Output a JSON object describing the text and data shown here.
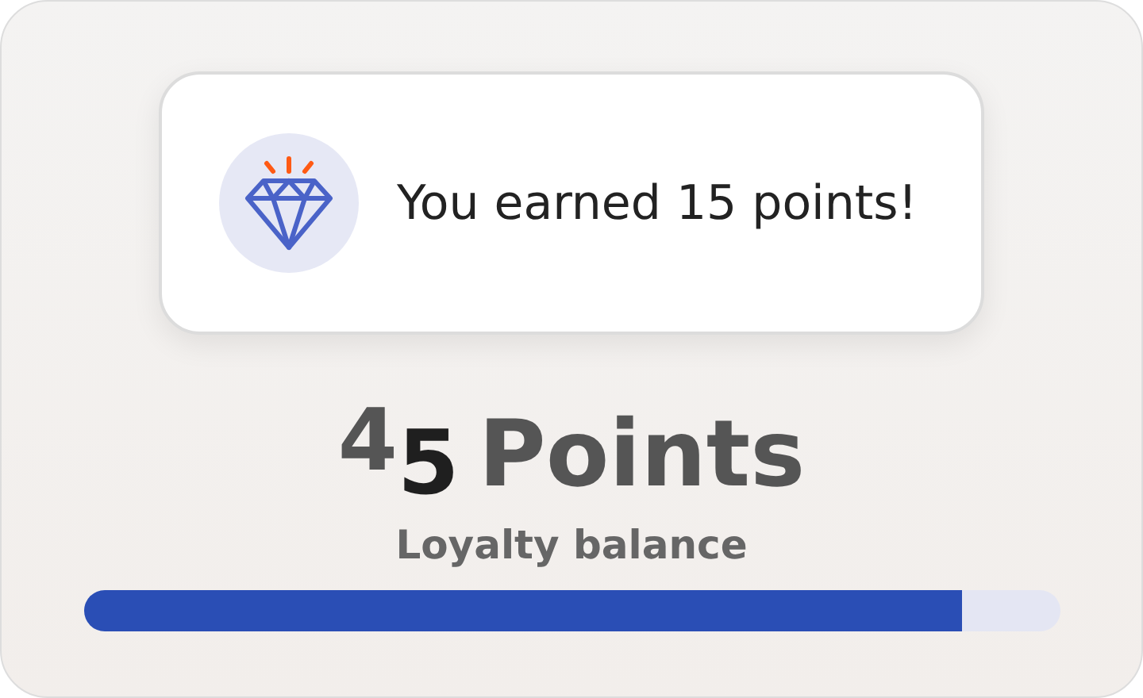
{
  "toast": {
    "message": "You earned 15 points!"
  },
  "balance": {
    "digits": [
      "4",
      "5"
    ],
    "unit": "Points",
    "label": "Loyalty balance"
  },
  "progress": {
    "level": 0.9
  }
}
